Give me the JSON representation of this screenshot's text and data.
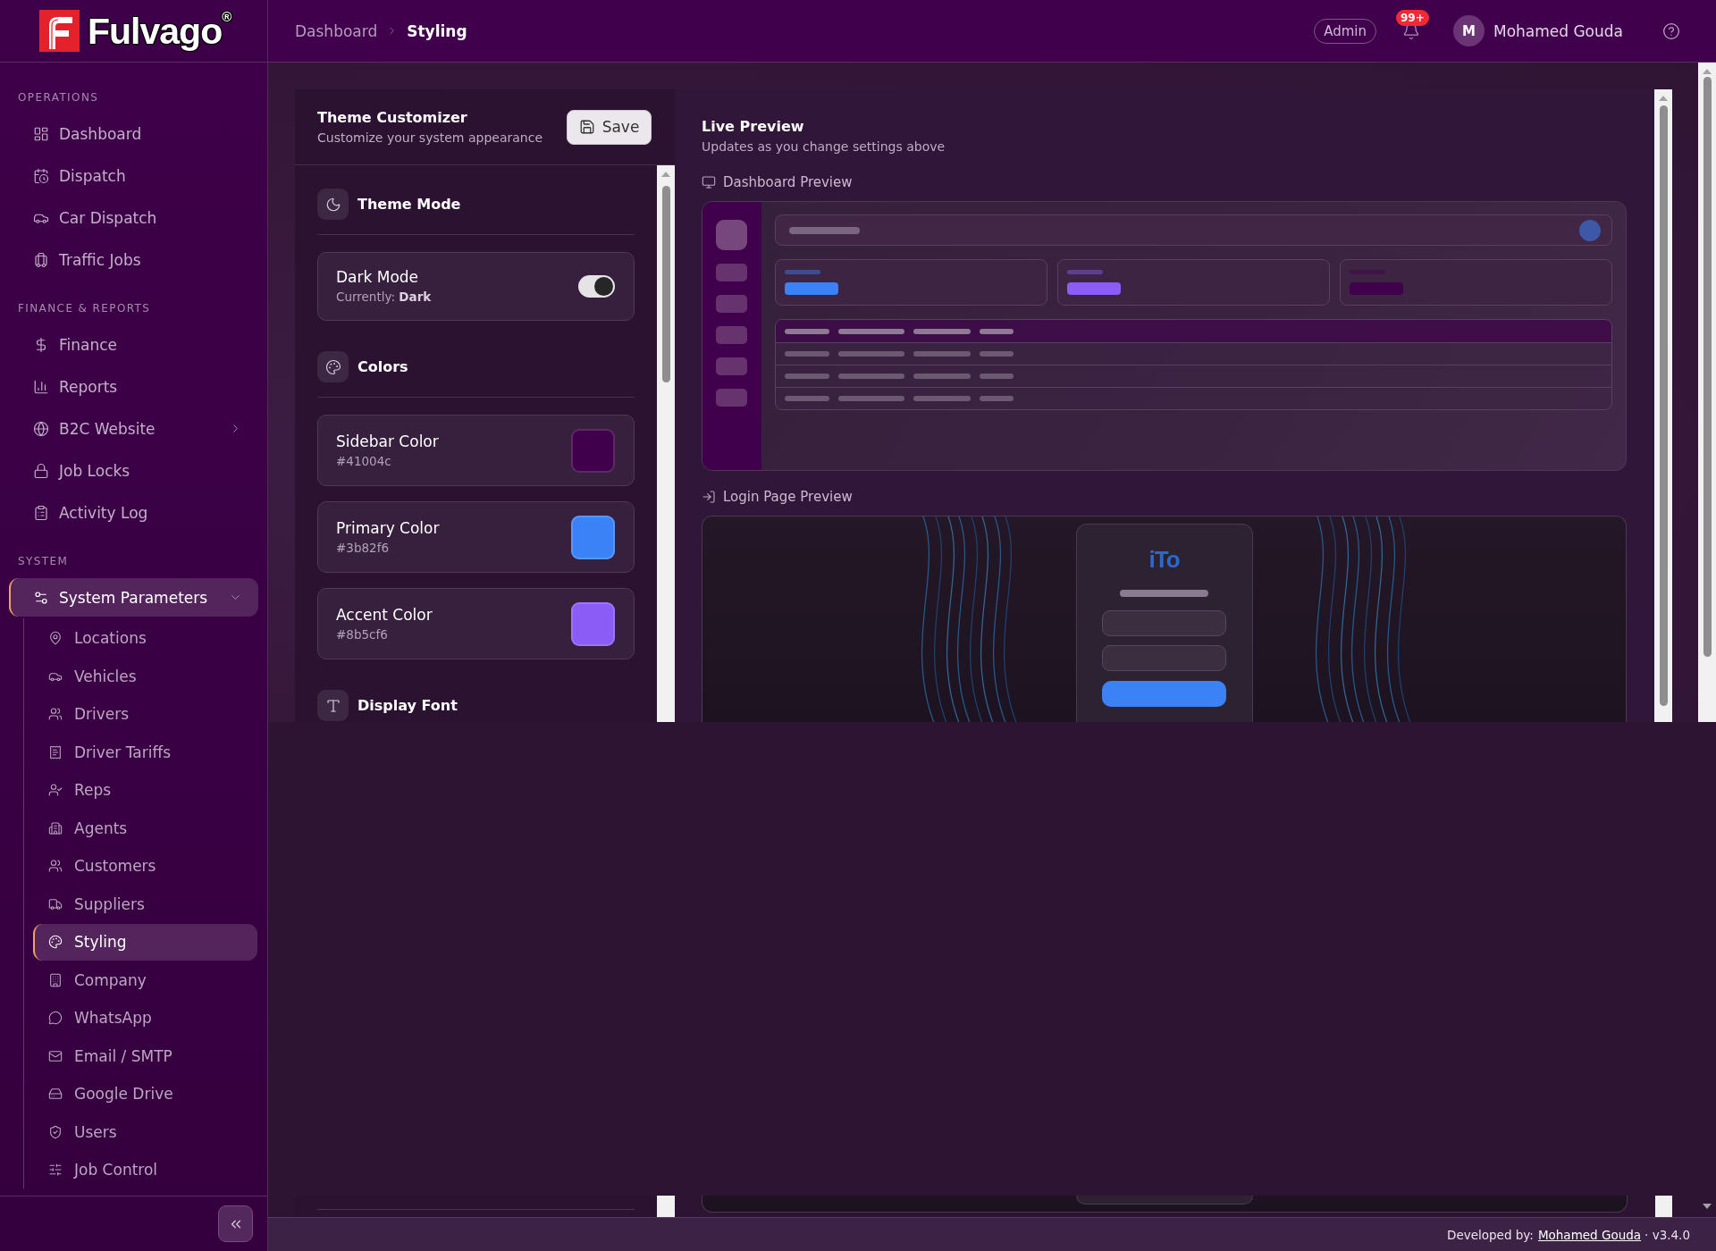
{
  "sidebar": {
    "logo": {
      "text": "Fulvago",
      "registered": "®"
    },
    "sections": [
      {
        "title": "OPERATIONS",
        "items": [
          {
            "label": "Dashboard",
            "kind": "link",
            "selected": false
          },
          {
            "label": "Dispatch",
            "kind": "link",
            "selected": false
          },
          {
            "label": "Car Dispatch",
            "kind": "link",
            "selected": false
          },
          {
            "label": "Traffic Jobs",
            "kind": "link",
            "selected": false
          }
        ]
      },
      {
        "title": "FINANCE & REPORTS",
        "items": [
          {
            "label": "Finance",
            "kind": "link",
            "selected": false
          },
          {
            "label": "Reports",
            "kind": "link",
            "selected": false
          },
          {
            "label": "B2C Website",
            "kind": "group",
            "selected": false,
            "expanded": false
          },
          {
            "label": "Job Locks",
            "kind": "link",
            "selected": false
          },
          {
            "label": "Activity Log",
            "kind": "link",
            "selected": false
          }
        ]
      },
      {
        "title": "SYSTEM",
        "items": [
          {
            "label": "System Parameters",
            "kind": "group",
            "selected": true,
            "expanded": true,
            "children": [
              {
                "label": "Locations",
                "selected": false
              },
              {
                "label": "Vehicles",
                "selected": false
              },
              {
                "label": "Drivers",
                "selected": false
              },
              {
                "label": "Driver Tariffs",
                "selected": false
              },
              {
                "label": "Reps",
                "selected": false
              },
              {
                "label": "Agents",
                "selected": false
              },
              {
                "label": "Customers",
                "selected": false
              },
              {
                "label": "Suppliers",
                "selected": false
              },
              {
                "label": "Styling",
                "selected": true
              },
              {
                "label": "Company",
                "selected": false
              },
              {
                "label": "WhatsApp",
                "selected": false
              },
              {
                "label": "Email / SMTP",
                "selected": false
              },
              {
                "label": "Google Drive",
                "selected": false
              },
              {
                "label": "Users",
                "selected": false
              },
              {
                "label": "Job Control",
                "selected": false
              }
            ]
          }
        ]
      }
    ]
  },
  "header": {
    "breadcrumb": [
      {
        "label": "Dashboard",
        "selected": false
      },
      {
        "label": "Styling",
        "selected": true
      }
    ],
    "role": "Admin",
    "notifications": "99+",
    "user": {
      "initial": "M",
      "name": "Mohamed Gouda"
    }
  },
  "theme_customizer": {
    "title": "Theme Customizer",
    "subtitle": "Customize your system appearance",
    "save_button": "Save",
    "sections": [
      {
        "kind": "mode",
        "title": "Theme Mode",
        "items": [
          {
            "label": "Dark Mode",
            "hint": "Currently: **Dark**",
            "on": true
          }
        ]
      },
      {
        "kind": "colors",
        "title": "Colors",
        "items": [
          {
            "label": "Sidebar Color",
            "value": "#41004c",
            "color": "#41004c"
          },
          {
            "label": "Primary Color",
            "value": "#3b82f6",
            "color": "#3b82f6"
          },
          {
            "label": "Accent Color",
            "value": "#8b5cf6",
            "color": "#8b5cf6"
          }
        ]
      },
      {
        "kind": "font",
        "title": "Display Font"
      }
    ]
  },
  "live_preview": {
    "title": "Live Preview",
    "subtitle": "Updates as you change settings above",
    "dashboard_preview": {
      "label": "Dashboard Preview"
    },
    "login_preview": {
      "label": "Login Page Preview",
      "logo": "iTo"
    }
  },
  "footer": {
    "prefix": "Developed by:",
    "author": "Mohamed Gouda",
    "version": "· v3.4.0"
  }
}
